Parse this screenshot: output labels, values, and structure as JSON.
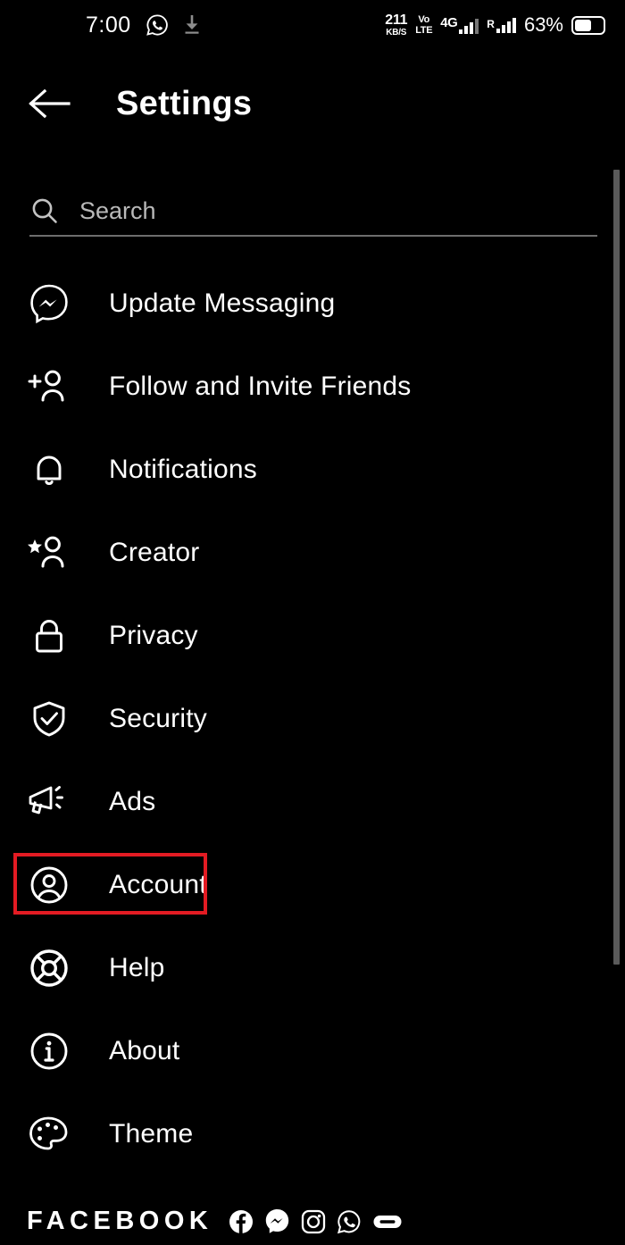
{
  "statusbar": {
    "time": "7:00",
    "left_icons": [
      "whatsapp-icon",
      "download-icon"
    ],
    "net_speed_value": "211",
    "net_speed_unit": "KB/S",
    "volte_line1": "Vo",
    "volte_line2": "LTE",
    "network_type": "4G",
    "roaming_label": "R",
    "battery_percent": "63%"
  },
  "header": {
    "back_icon": "arrow-left-icon",
    "title": "Settings"
  },
  "search": {
    "icon": "search-icon",
    "placeholder": "Search",
    "value": ""
  },
  "menu": {
    "items": [
      {
        "label": "Update Messaging",
        "icon": "messenger-icon",
        "highlighted": false
      },
      {
        "label": "Follow and Invite Friends",
        "icon": "person-add-icon",
        "highlighted": false
      },
      {
        "label": "Notifications",
        "icon": "bell-icon",
        "highlighted": false
      },
      {
        "label": "Creator",
        "icon": "person-star-icon",
        "highlighted": false
      },
      {
        "label": "Privacy",
        "icon": "lock-icon",
        "highlighted": false
      },
      {
        "label": "Security",
        "icon": "shield-check-icon",
        "highlighted": false
      },
      {
        "label": "Ads",
        "icon": "megaphone-icon",
        "highlighted": false
      },
      {
        "label": "Account",
        "icon": "account-circle-icon",
        "highlighted": true
      },
      {
        "label": "Help",
        "icon": "life-ring-icon",
        "highlighted": false
      },
      {
        "label": "About",
        "icon": "info-circle-icon",
        "highlighted": false
      },
      {
        "label": "Theme",
        "icon": "palette-icon",
        "highlighted": false
      }
    ]
  },
  "footer": {
    "wordmark": "FACEBOOK",
    "brand_icons": [
      "facebook-icon",
      "messenger-icon",
      "instagram-icon",
      "whatsapp-icon",
      "oculus-icon"
    ]
  },
  "colors": {
    "background": "#000000",
    "text": "#ffffff",
    "muted_text": "#b9b9b9",
    "highlight_border": "#e31b23",
    "scrollbar": "#5a5a5a",
    "divider": "#6d6d6d"
  }
}
